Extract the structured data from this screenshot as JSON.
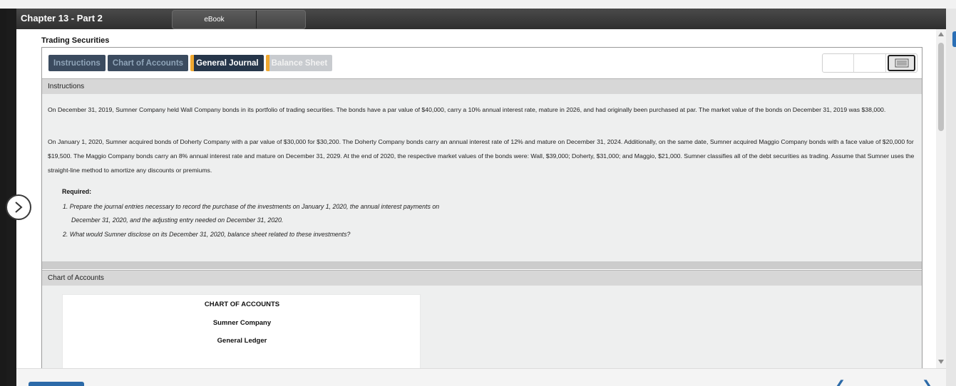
{
  "window": {
    "chapter_title": "Chapter 13 - Part 2"
  },
  "top_tabs": {
    "ebook": "eBook"
  },
  "page": {
    "heading": "Trading Securities"
  },
  "tabs": [
    {
      "label": "Instructions"
    },
    {
      "label": "Chart of Accounts"
    },
    {
      "label": "General Journal",
      "flag": "!"
    },
    {
      "label": "Balance Sheet",
      "flag": "!"
    }
  ],
  "instructions": {
    "header": "Instructions",
    "para1": "On December 31, 2019, Sumner Company held Wall Company bonds in its portfolio of trading securities. The bonds have a par value of $40,000, carry a 10% annual interest rate, mature in 2026, and had originally been purchased at par. The market value of the bonds on December 31, 2019 was $38,000.",
    "para2": "On January 1, 2020, Sumner acquired bonds of Doherty Company with a par value of $30,000 for $30,200. The Doherty Company bonds carry an annual interest rate of 12% and mature on December 31, 2024. Additionally, on the same date, Sumner acquired Maggio Company bonds with a face value of $20,000 for $19,500. The Maggio Company bonds carry an 8% annual interest rate and mature on December 31, 2029. At the end of 2020, the respective market values of the bonds were: Wall, $39,000; Doherty, $31,000; and Maggio, $21,000. Sumner classifies all of the debt securities as trading. Assume that Sumner uses the straight-line method to amortize any discounts or premiums.",
    "required_label": "Required:",
    "req1_line1": "1.  Prepare the journal entries necessary to record the purchase of the investments on January 1, 2020, the annual interest payments on",
    "req1_line2": "December 31, 2020, and the adjusting entry needed on December 31, 2020.",
    "req2": "2.  What would Sumner disclose on its December 31, 2020, balance sheet related to these investments?"
  },
  "chart_of_accounts": {
    "header": "Chart of Accounts",
    "title": "CHART OF ACCOUNTS",
    "company": "Sumner Company",
    "ledger": "General Ledger"
  },
  "colors": {
    "accent_orange": "#f0a830",
    "tab_navy": "#26364a",
    "link_blue": "#2c6aa8"
  }
}
